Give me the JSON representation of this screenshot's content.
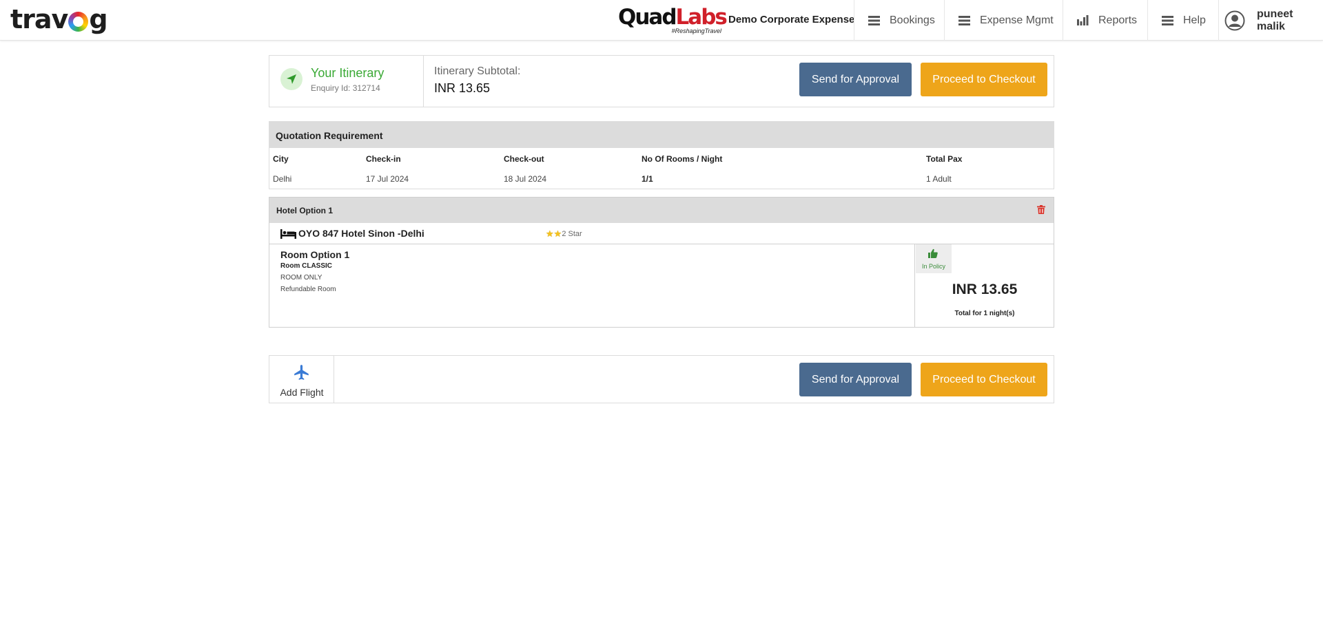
{
  "header": {
    "logo_text_left": "trav",
    "logo_text_right": "g",
    "brand_quad": "Quad",
    "brand_labs": "Labs",
    "brand_tagline": "#ReshapingTravel",
    "company": "Demo Corporate Expense",
    "nav": {
      "bookings": "Bookings",
      "expense": "Expense Mgmt",
      "reports": "Reports",
      "help": "Help"
    },
    "user_name": "puneet malik"
  },
  "itinerary": {
    "title": "Your Itinerary",
    "enquiry": "Enquiry Id: 312714",
    "subtotal_label": "Itinerary Subtotal:",
    "subtotal_value": "INR  13.65",
    "send_approval": "Send for Approval",
    "checkout": "Proceed to Checkout"
  },
  "quotation": {
    "title": "Quotation Requirement",
    "headers": [
      "City",
      "Check-in",
      "Check-out",
      "No Of Rooms / Night",
      "Total Pax"
    ],
    "values": [
      "Delhi",
      "17 Jul 2024",
      "18 Jul 2024",
      "1/1",
      "1 Adult"
    ]
  },
  "hotel": {
    "option_title": "Hotel Option 1",
    "name": "OYO 847 Hotel Sinon -Delhi",
    "star_label": "2 Star",
    "star_rating": 2,
    "room_title": "Room Option 1",
    "room_type": "Room CLASSIC",
    "meal": "ROOM ONLY",
    "refund": "Refundable Room",
    "policy": "In Policy",
    "price": "INR 13.65",
    "price_note": "Total for 1 night(s)"
  },
  "bottom": {
    "add_flight": "Add Flight",
    "send_approval": "Send for Approval",
    "checkout": "Proceed to Checkout"
  },
  "colors": {
    "approve": "#4a6a8f",
    "checkout": "#eea51a",
    "itinerary_green": "#3aa935",
    "delete_red": "#d9342b",
    "flight_blue": "#3a7bd5"
  }
}
